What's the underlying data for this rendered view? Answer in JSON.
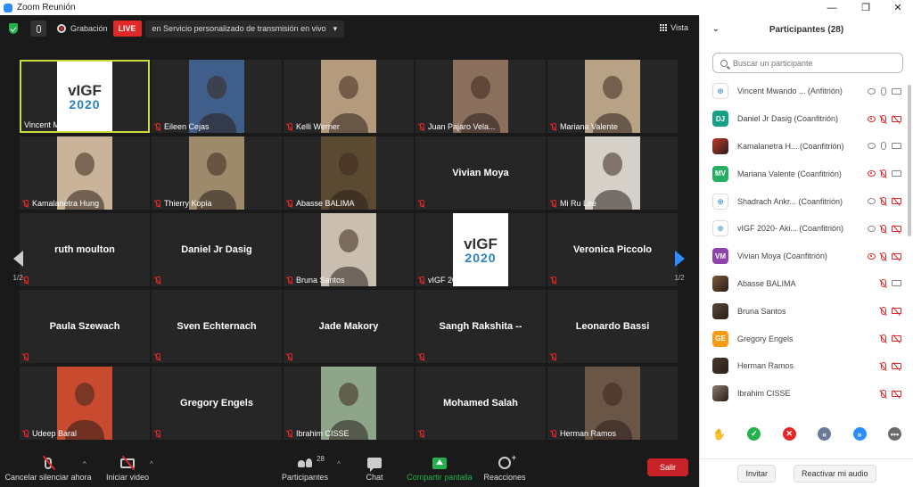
{
  "window": {
    "title": "Zoom Reunión",
    "minimize": "—",
    "restore": "❐",
    "close": "✕"
  },
  "topbar": {
    "recording_label": "Grabación",
    "live_badge": "LIVE",
    "stream_label": "en Servicio personalizado de transmisión en vivo",
    "stream_caret": "▾",
    "view_label": "Vista"
  },
  "tiles": [
    {
      "name": "Vincent Mwando (vi...",
      "video": "logo",
      "active": true,
      "muted": false
    },
    {
      "name": "Eileen Cejas",
      "video": "#3f5e8a",
      "muted": true
    },
    {
      "name": "Kelli Werner",
      "video": "#b59b7e",
      "muted": true
    },
    {
      "name": "Juan Pajaro Vela...",
      "video": "#8a6f5d",
      "muted": true
    },
    {
      "name": "Mariana Valente",
      "video": "#b7a286",
      "muted": true
    },
    {
      "name": "Kamalanetra Hung",
      "video": "#c9b49a",
      "muted": true
    },
    {
      "name": "Thierry Kopia",
      "video": "#9c8a6b",
      "muted": true
    },
    {
      "name": "Abasse BALIMA",
      "video": "#5b4a32",
      "muted": true
    },
    {
      "name": "Vivian Moya",
      "center": "Vivian Moya",
      "muted": true,
      "hide_label": true
    },
    {
      "name": "Mi Ru Lee",
      "video": "#d5d0c8",
      "muted": true
    },
    {
      "name": "ruth moulton",
      "center": "ruth moulton",
      "muted": true,
      "hide_label": true
    },
    {
      "name": "Daniel Jr Dasig",
      "center": "Daniel Jr Dasig",
      "muted": true,
      "hide_label": true
    },
    {
      "name": "Bruna Santos",
      "video": "#c9beb0",
      "muted": true
    },
    {
      "name": "vIGF 2020 - Akinb...",
      "video": "logo",
      "muted": true
    },
    {
      "name": "Veronica Piccolo",
      "center": "Veronica Piccolo",
      "muted": true,
      "hide_label": true
    },
    {
      "name": "Paula Szewach",
      "center": "Paula Szewach",
      "muted": true,
      "hide_label": true
    },
    {
      "name": "Sven Echternach",
      "center": "Sven Echternach",
      "muted": true,
      "hide_label": true
    },
    {
      "name": "Jade Makory",
      "center": "Jade Makory",
      "muted": true,
      "hide_label": true
    },
    {
      "name": "Sangh Rakshita --",
      "center": "Sangh Rakshita --",
      "muted": true,
      "hide_label": true
    },
    {
      "name": "Leonardo Bassi",
      "center": "Leonardo Bassi",
      "muted": true,
      "hide_label": true
    },
    {
      "name": "Udeep Baral",
      "video": "#c84a2f",
      "muted": true
    },
    {
      "name": "Gregory Engels",
      "center": "Gregory Engels",
      "muted": true,
      "hide_label": true
    },
    {
      "name": "Ibrahim CISSE",
      "video": "#8fa58a",
      "muted": true
    },
    {
      "name": "Mohamed Salah",
      "center": "Mohamed Salah",
      "muted": true,
      "hide_label": true
    },
    {
      "name": "Herman Ramos",
      "video": "#6a5646",
      "muted": true
    }
  ],
  "logo": {
    "top": "vIGF",
    "bottom": "2020"
  },
  "pagination": {
    "left": "1/2",
    "right": "1/2"
  },
  "toolbar": {
    "unmute": "Cancelar silenciar ahora",
    "start_video": "Iniciar video",
    "participants": "Participantes",
    "participants_count": "28",
    "chat": "Chat",
    "share": "Compartir pantalla",
    "reactions": "Reacciones",
    "leave": "Salir",
    "caret": "^"
  },
  "panel": {
    "title": "Participantes (28)",
    "collapse": "⌄",
    "search_placeholder": "Buscar un participante",
    "participants": [
      {
        "name": "Vincent Mwando ... (Anfitrión)",
        "avatar": "logo",
        "initials": "",
        "rec": "off",
        "mic": "on",
        "cam": "on"
      },
      {
        "name": "Daniel Jr Dasig (Coanfitrión)",
        "avatar": "initials",
        "initials": "DJ",
        "color": "#16a085",
        "rec": "on",
        "mic": "off",
        "cam": "off"
      },
      {
        "name": "Kamalanetra H... (Coanfitrión)",
        "avatar": "image",
        "initials": "",
        "color": "#c0392b",
        "rec": "off",
        "mic": "on",
        "cam": "on"
      },
      {
        "name": "Mariana Valente (Coanfitrión)",
        "avatar": "initials",
        "initials": "MV",
        "color": "#27ae60",
        "rec": "on",
        "mic": "off",
        "cam": "on"
      },
      {
        "name": "Shadrach Ankr... (Coanfitrión)",
        "avatar": "logo",
        "initials": "",
        "rec": "off",
        "mic": "off",
        "cam": "off"
      },
      {
        "name": "vIGF 2020- Aki... (Coanfitrión)",
        "avatar": "logo",
        "initials": "",
        "rec": "off",
        "mic": "off",
        "cam": "off"
      },
      {
        "name": "Vivian Moya (Coanfitrión)",
        "avatar": "initials",
        "initials": "VM",
        "color": "#8e44ad",
        "rec": "on",
        "mic": "off",
        "cam": "off"
      },
      {
        "name": "Abasse BALIMA",
        "avatar": "image",
        "initials": "",
        "color": "#7a5a3a",
        "rec": "",
        "mic": "off",
        "cam": "on"
      },
      {
        "name": "Bruna Santos",
        "avatar": "image",
        "initials": "",
        "color": "#5a4638",
        "rec": "",
        "mic": "off",
        "cam": "off"
      },
      {
        "name": "Gregory Engels",
        "avatar": "initials",
        "initials": "GE",
        "color": "#f39c12",
        "rec": "",
        "mic": "off",
        "cam": "off"
      },
      {
        "name": "Herman Ramos",
        "avatar": "image",
        "initials": "",
        "color": "#4a3a2e",
        "rec": "",
        "mic": "off",
        "cam": "off"
      },
      {
        "name": "Ibrahim CISSE",
        "avatar": "image",
        "initials": "",
        "color": "#8a7a6a",
        "rec": "",
        "mic": "off",
        "cam": "off"
      }
    ],
    "reactions": [
      {
        "name": "raise-hand",
        "symbol": "✋",
        "color": "#2d8cff",
        "plain": true
      },
      {
        "name": "yes",
        "symbol": "✓",
        "color": "#23b14d"
      },
      {
        "name": "no",
        "symbol": "✕",
        "color": "#e02828"
      },
      {
        "name": "go-slower",
        "symbol": "«",
        "color": "#6b7a99"
      },
      {
        "name": "go-faster",
        "symbol": "»",
        "color": "#2d8cff"
      },
      {
        "name": "more",
        "symbol": "•••",
        "color": "#6b6b6b"
      }
    ],
    "invite": "Invitar",
    "unmute_me": "Reactivar mi audio"
  }
}
